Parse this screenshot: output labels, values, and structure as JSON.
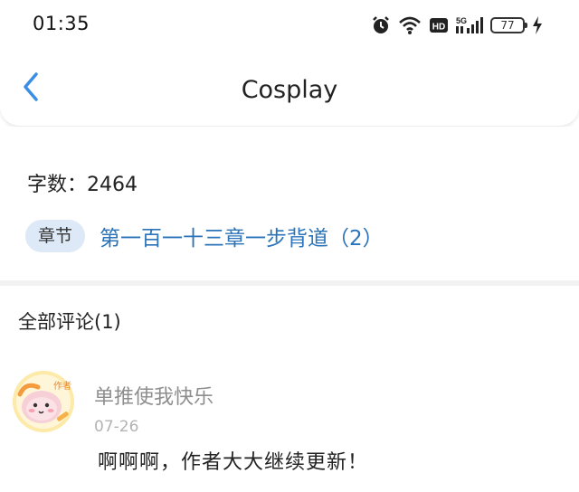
{
  "status_bar": {
    "time": "01:35",
    "battery_level": "77",
    "network_label": "5G",
    "hd_label": "HD",
    "icons": [
      "alarm-icon",
      "wifi-icon",
      "hd-icon",
      "signal-icon",
      "battery-icon",
      "charging-icon"
    ]
  },
  "header": {
    "title": "Cosplay",
    "back_icon": "chevron-left-icon"
  },
  "info": {
    "word_count": "字数：2464",
    "chapter_tag": "章节",
    "chapter_title": "第一百一十三章一步背道（2）"
  },
  "comments": {
    "header": "全部评论(1)",
    "items": [
      {
        "username": "单推使我快乐",
        "date": "07-26",
        "text": "啊啊啊，作者大大继续更新！",
        "avatar_badge": "作者"
      }
    ]
  },
  "colors": {
    "accent_link": "#2c74b9",
    "back_arrow": "#3a8ee6",
    "tag_background": "#dde9f7",
    "username": "#8e8e8e",
    "date": "#b3b3b3"
  }
}
